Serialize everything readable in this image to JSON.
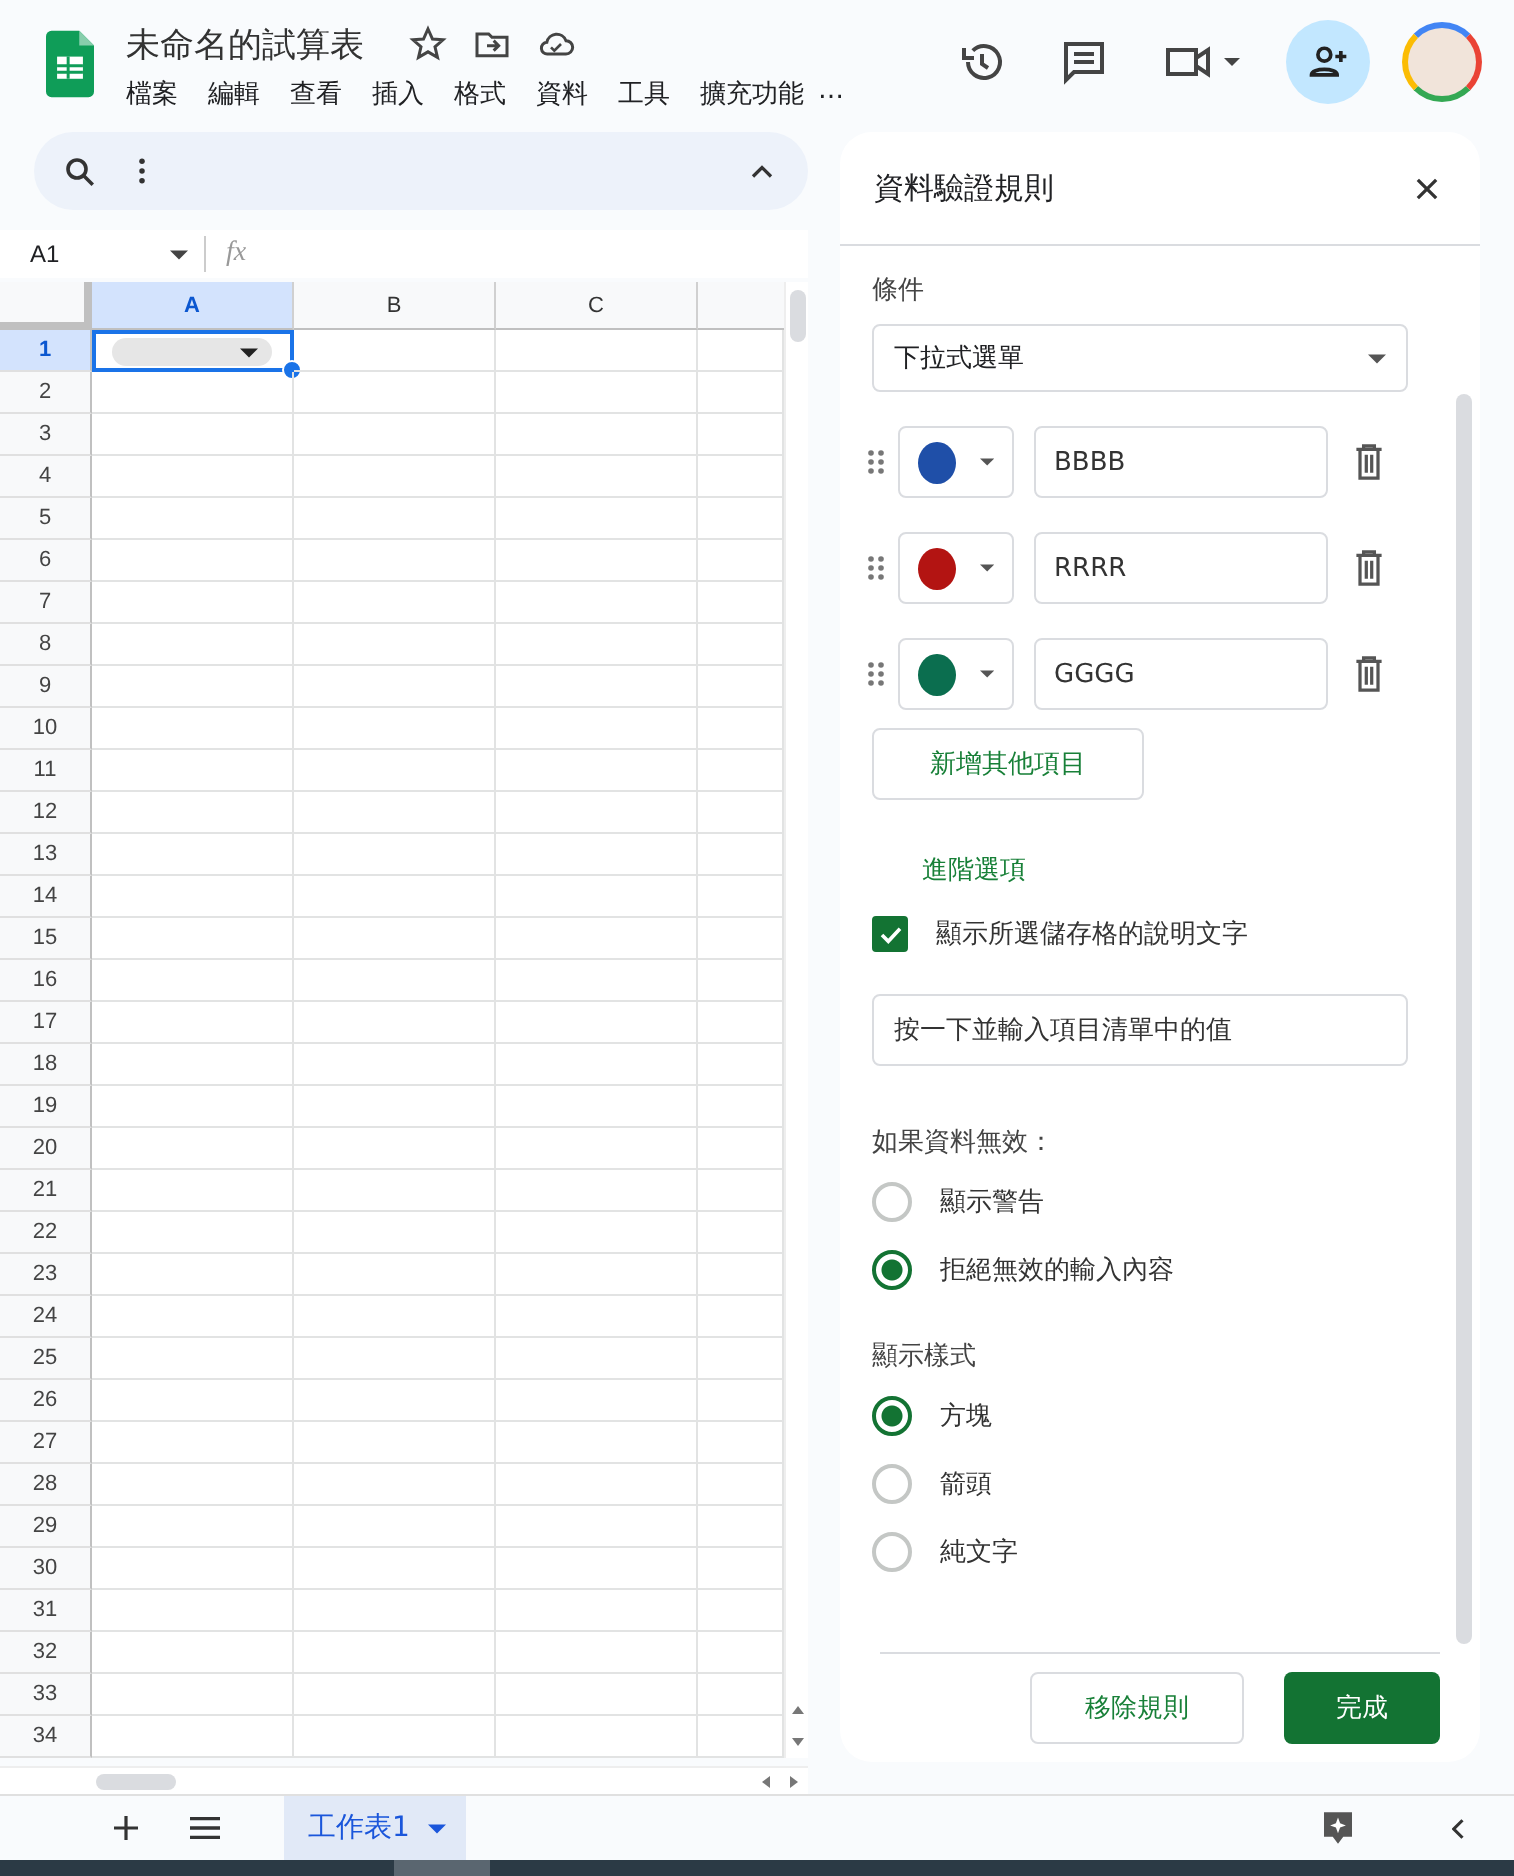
{
  "app": {
    "title": "未命名的試算表",
    "menu": [
      "檔案",
      "編輯",
      "查看",
      "插入",
      "格式",
      "資料",
      "工具",
      "擴充功能",
      "…"
    ]
  },
  "formula_bar": {
    "cell_ref": "A1",
    "fx": "fx"
  },
  "sheet": {
    "columns": [
      {
        "label": "A",
        "selected": true
      },
      {
        "label": "B",
        "selected": false
      },
      {
        "label": "C",
        "selected": false
      }
    ],
    "rows": [
      {
        "label": "1",
        "selected": true
      },
      {
        "label": "2",
        "selected": false
      },
      {
        "label": "3",
        "selected": false
      },
      {
        "label": "4",
        "selected": false
      },
      {
        "label": "5",
        "selected": false
      },
      {
        "label": "6",
        "selected": false
      },
      {
        "label": "7",
        "selected": false
      },
      {
        "label": "8",
        "selected": false
      },
      {
        "label": "9",
        "selected": false
      },
      {
        "label": "10",
        "selected": false
      },
      {
        "label": "11",
        "selected": false
      },
      {
        "label": "12",
        "selected": false
      },
      {
        "label": "13",
        "selected": false
      },
      {
        "label": "14",
        "selected": false
      },
      {
        "label": "15",
        "selected": false
      },
      {
        "label": "16",
        "selected": false
      },
      {
        "label": "17",
        "selected": false
      },
      {
        "label": "18",
        "selected": false
      },
      {
        "label": "19",
        "selected": false
      },
      {
        "label": "20",
        "selected": false
      },
      {
        "label": "21",
        "selected": false
      },
      {
        "label": "22",
        "selected": false
      },
      {
        "label": "23",
        "selected": false
      },
      {
        "label": "24",
        "selected": false
      },
      {
        "label": "25",
        "selected": false
      },
      {
        "label": "26",
        "selected": false
      },
      {
        "label": "27",
        "selected": false
      },
      {
        "label": "28",
        "selected": false
      },
      {
        "label": "29",
        "selected": false
      },
      {
        "label": "30",
        "selected": false
      },
      {
        "label": "31",
        "selected": false
      },
      {
        "label": "32",
        "selected": false
      },
      {
        "label": "33",
        "selected": false
      },
      {
        "label": "34",
        "selected": false
      }
    ]
  },
  "panel": {
    "title": "資料驗證規則",
    "criteria_label": "條件",
    "criteria_value": "下拉式選單",
    "items": [
      {
        "color": "#1f4fa8",
        "value": "BBBB"
      },
      {
        "color": "#b31412",
        "value": "RRRR"
      },
      {
        "color": "#0b6e4f",
        "value": "GGGG"
      }
    ],
    "add_button": "新增其他項目",
    "advanced_link": "進階選項",
    "help_checkbox": {
      "label": "顯示所選儲存格的說明文字",
      "checked": true
    },
    "help_text": "按一下並輸入項目清單中的值",
    "invalid_label": "如果資料無效：",
    "invalid_options": [
      {
        "label": "顯示警告",
        "selected": false
      },
      {
        "label": "拒絕無效的輸入內容",
        "selected": true
      }
    ],
    "style_label": "顯示樣式",
    "style_options": [
      {
        "label": "方塊",
        "selected": true
      },
      {
        "label": "箭頭",
        "selected": false
      },
      {
        "label": "純文字",
        "selected": false
      }
    ],
    "remove_button": "移除規則",
    "done_button": "完成"
  },
  "sheet_tabs": [
    {
      "label": "工作表1",
      "selected": true
    }
  ]
}
